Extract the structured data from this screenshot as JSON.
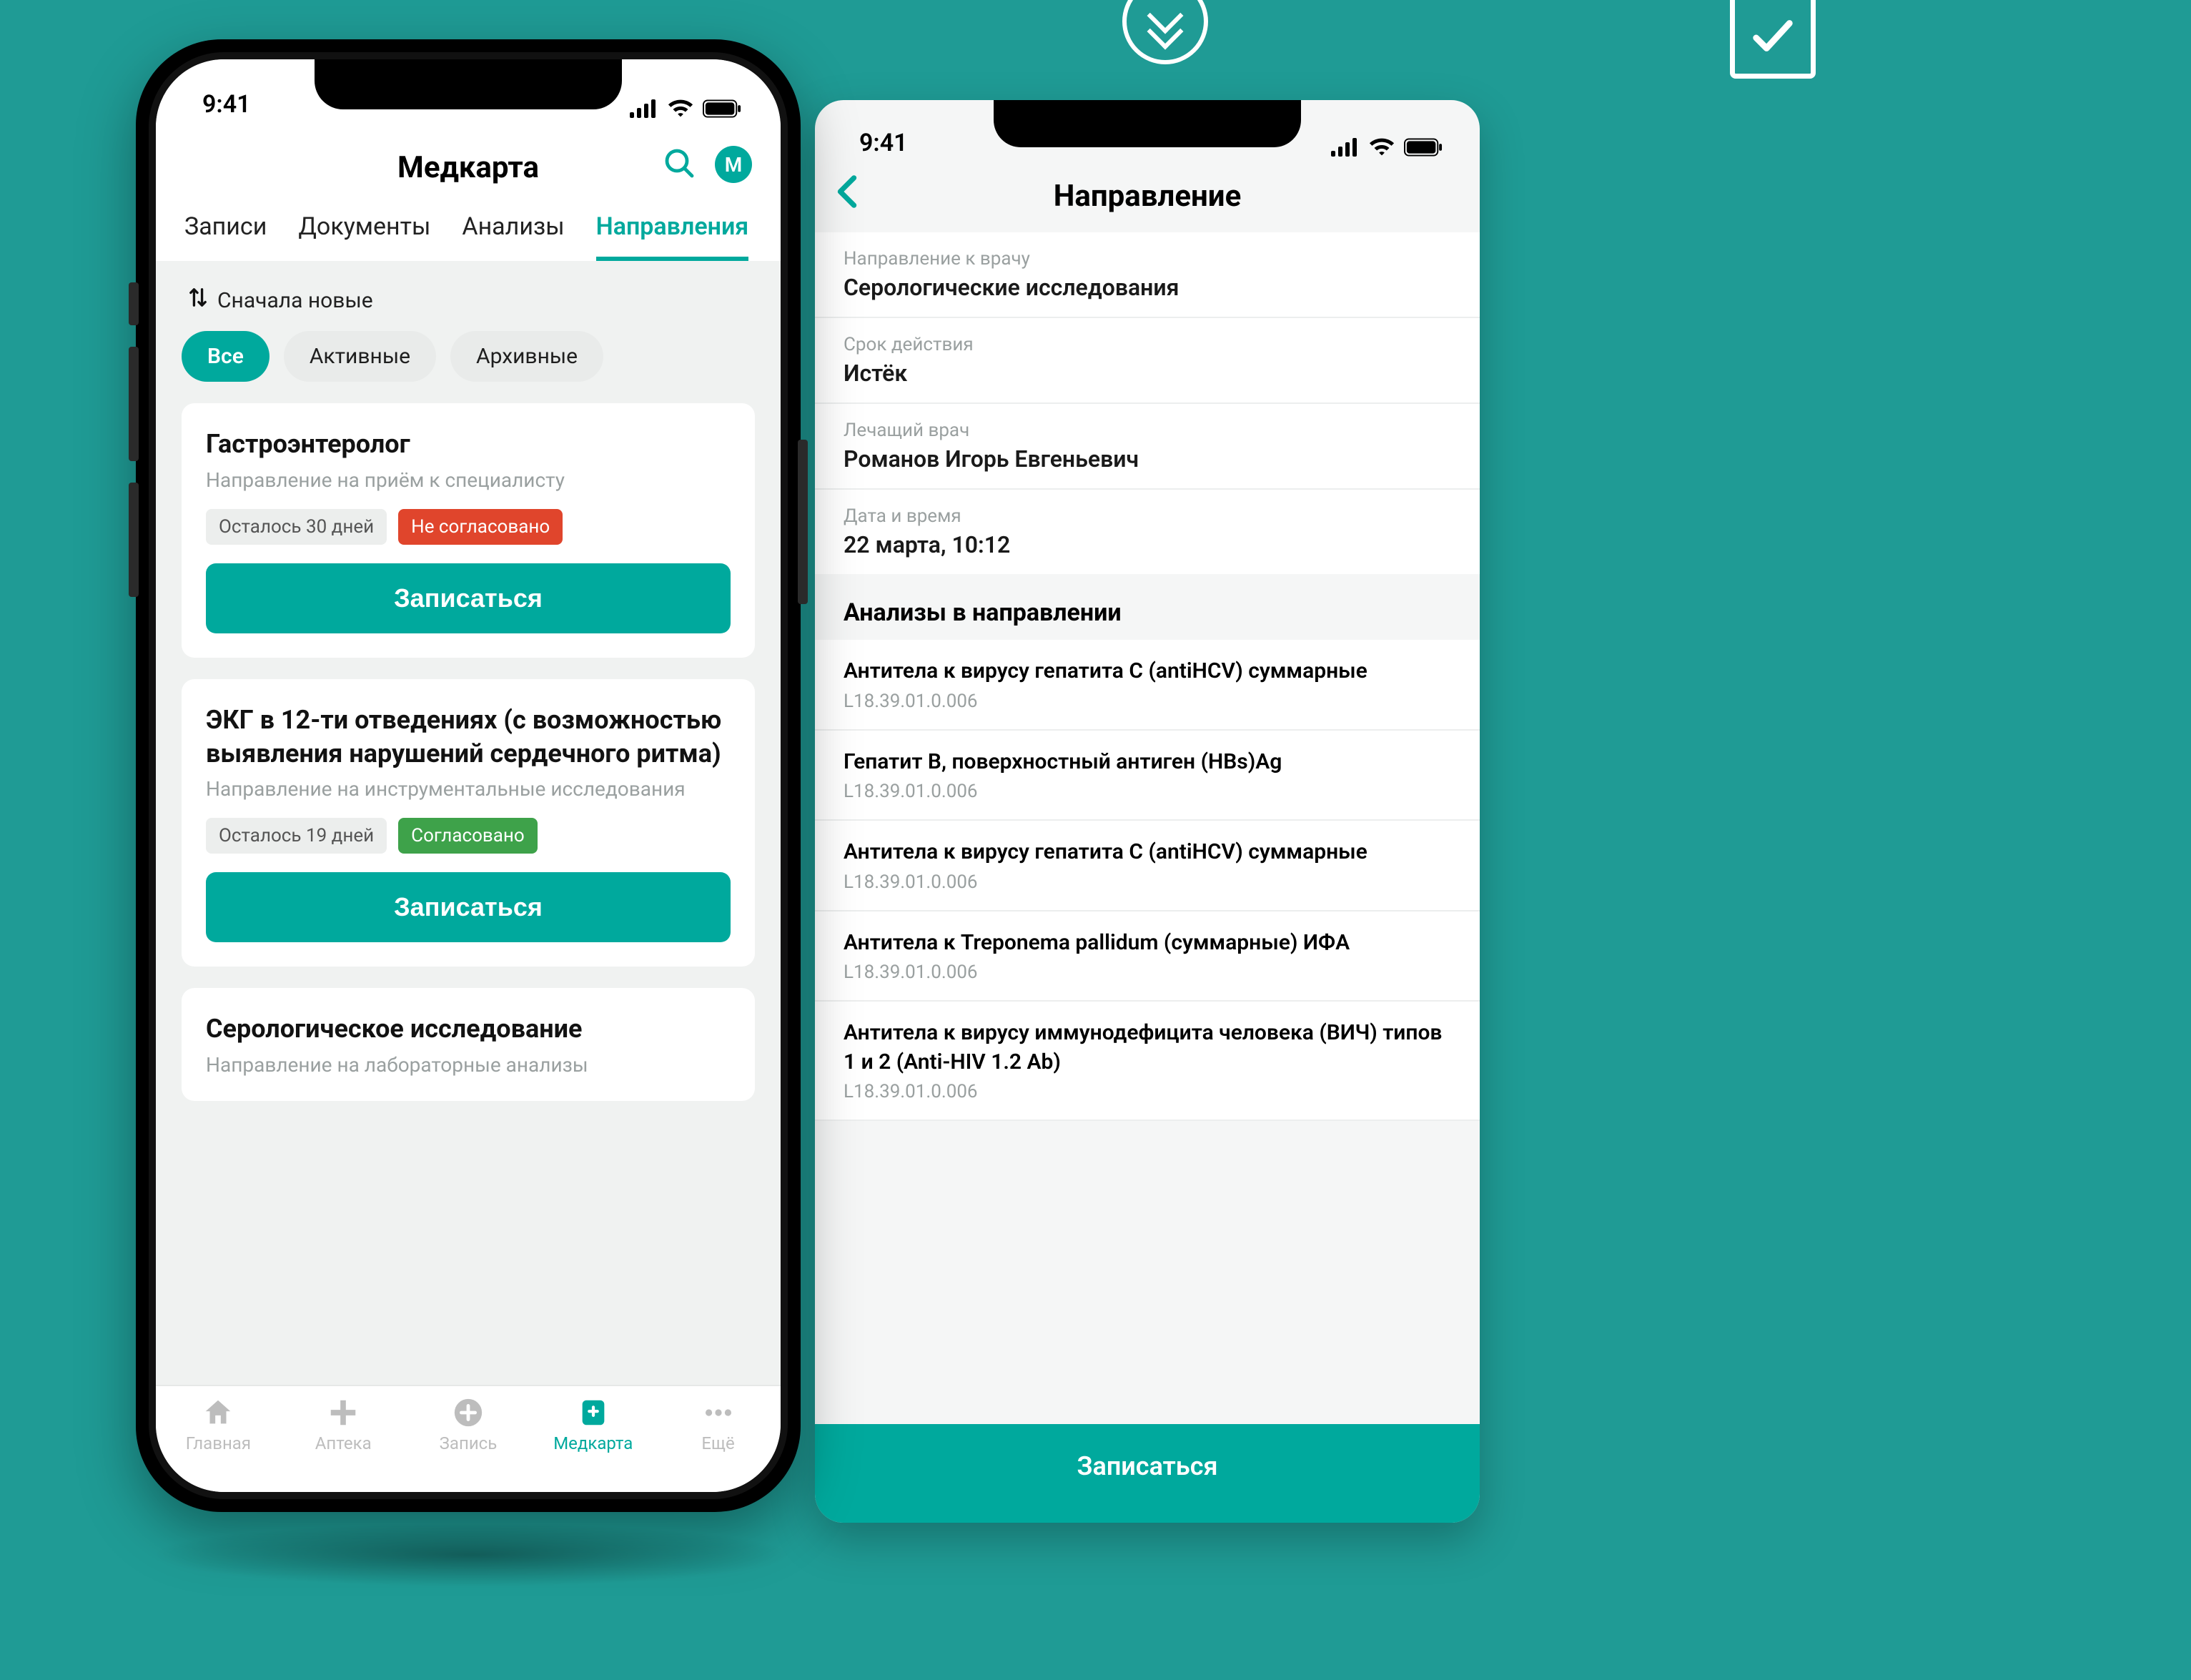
{
  "status_time": "9:41",
  "phone1": {
    "title": "Медкарта",
    "avatar_initial": "M",
    "tabs": [
      "Записи",
      "Документы",
      "Анализы",
      "Направления"
    ],
    "active_tab_index": 3,
    "sort_label": "Сначала новые",
    "chips": [
      {
        "label": "Все",
        "active": true
      },
      {
        "label": "Активные",
        "active": false
      },
      {
        "label": "Архивные",
        "active": false
      }
    ],
    "cards": [
      {
        "title": "Гастроэнтеролог",
        "subtitle": "Направление на приём к специалисту",
        "days_badge": "Осталось 30 дней",
        "status_badge": "Не согласовано",
        "status_kind": "red",
        "cta": "Записаться"
      },
      {
        "title": "ЭКГ в 12-ти отведениях (с возможностью выявления нарушений сердечного ритма)",
        "subtitle": "Направление на инструментальные исследования",
        "days_badge": "Осталось 19 дней",
        "status_badge": "Согласовано",
        "status_kind": "green",
        "cta": "Записаться"
      },
      {
        "title": "Серологическое исследование",
        "subtitle": "Направление на лабораторные анализы"
      }
    ],
    "nav": [
      {
        "label": "Главная"
      },
      {
        "label": "Аптека"
      },
      {
        "label": "Запись"
      },
      {
        "label": "Медкарта"
      },
      {
        "label": "Ещё"
      }
    ],
    "nav_active_index": 3
  },
  "phone2": {
    "title": "Направление",
    "info": [
      {
        "label": "Направление к врачу",
        "value": "Серологические исследования"
      },
      {
        "label": "Срок действия",
        "value": "Истёк"
      },
      {
        "label": "Лечащий врач",
        "value": "Романов Игорь Евгеньевич"
      },
      {
        "label": "Дата и время",
        "value": "22 марта, 10:12"
      }
    ],
    "section_heading": "Анализы в направлении",
    "analyses": [
      {
        "title": "Антитела к вирусу гепатита C (antiHCV) суммарные",
        "code": "L18.39.01.0.006"
      },
      {
        "title": "Гепатит B, поверхностный антиген (HBs)Ag",
        "code": "L18.39.01.0.006"
      },
      {
        "title": "Антитела к вирусу гепатита C (antiHCV) суммарные",
        "code": "L18.39.01.0.006"
      },
      {
        "title": "Антитела к Treponema pallidum (суммарные) ИФА",
        "code": "L18.39.01.0.006"
      },
      {
        "title": "Антитела к вирусу иммунодефицита человека (ВИЧ) типов 1 и 2 (Anti-HIV 1.2 Ab)",
        "code": "L18.39.01.0.006"
      }
    ],
    "cta": "Записаться"
  }
}
